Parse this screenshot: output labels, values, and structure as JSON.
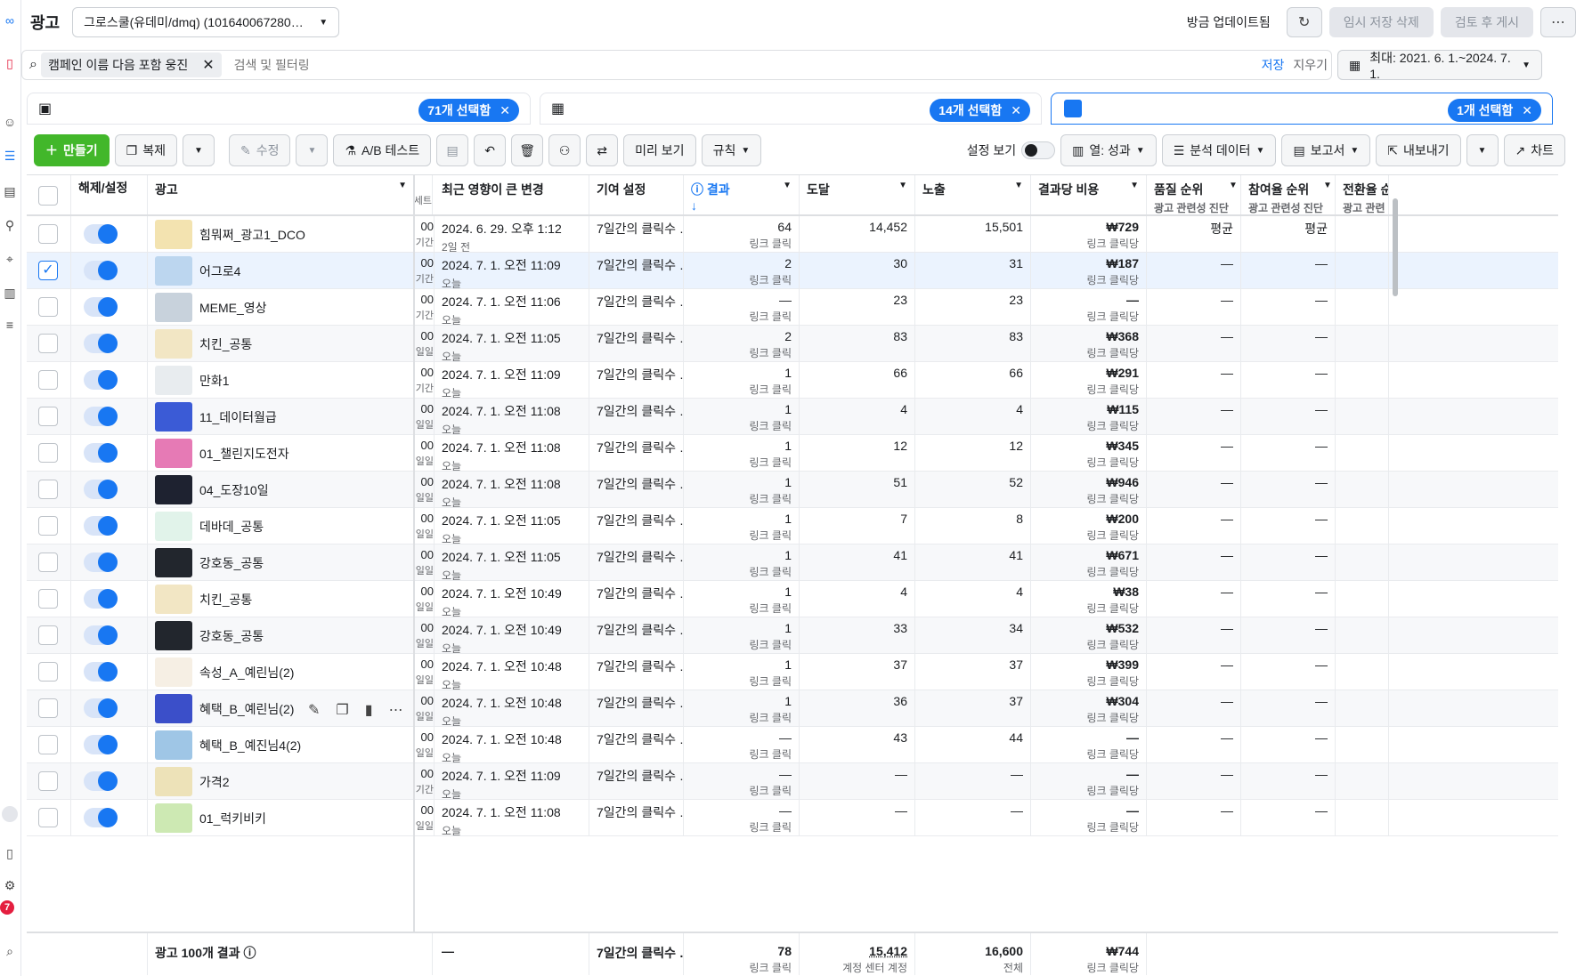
{
  "title": "광고",
  "account": "그로스쿨(유데미/dmq) (101640067280…",
  "top": {
    "updated": "방금 업데이트됨",
    "discard": "임시 저장 삭제",
    "review": "검토 후 게시"
  },
  "search": {
    "chip": "캠페인 이름 다음 포함 웅진",
    "placeholder": "검색 및 필터링",
    "save": "저장",
    "clear": "지우기",
    "date": "최대: 2021. 6. 1.~2024. 7. 1."
  },
  "panels": [
    "71개 선택함",
    "14개 선택함",
    "1개 선택함"
  ],
  "toolbar": {
    "create": "만들기",
    "duplicate": "복제",
    "edit": "수정",
    "ab": "A/B 테스트",
    "preview": "미리 보기",
    "rules": "규칙",
    "view_setup": "설정 보기",
    "columns": "열: 성과",
    "breakdown": "분석 데이터",
    "reports": "보고서",
    "export": "내보내기",
    "chart": "차트"
  },
  "headers": {
    "onoff": "해제/설정",
    "ad": "광고",
    "set": "세트",
    "change": "최근 영향이 큰 변경",
    "attribution": "기여 설정",
    "results": "결과",
    "reach": "도달",
    "impressions": "노출",
    "cpr": "결과당 비용",
    "quality": "품질 순위",
    "quality_sub": "광고 관련성 진단",
    "engage": "참여율 순위",
    "engage_sub": "광고 관련성 진단",
    "conv": "전환율 순",
    "conv_sub": "광고 관련"
  },
  "rows": [
    {
      "name": "힘뭐쩌_광고1_DCO",
      "frag": "00",
      "frag2": "기간",
      "change": "2024. 6. 29. 오후 1:12",
      "ago": "2일 전",
      "attr": "7일간의 클릭수 …",
      "res": "64",
      "rsub": "링크 클릭",
      "reach": "14,452",
      "imp": "15,501",
      "cpr": "₩729",
      "csub": "링크 클릭당",
      "q": "평균",
      "e": "평균"
    },
    {
      "name": "어그로4",
      "frag": "00",
      "frag2": "기간",
      "change": "2024. 7. 1. 오전 11:09",
      "ago": "오늘",
      "attr": "7일간의 클릭수 …",
      "res": "2",
      "rsub": "링크 클릭",
      "reach": "30",
      "imp": "31",
      "cpr": "₩187",
      "csub": "링크 클릭당",
      "q": "—",
      "e": "—"
    },
    {
      "name": "MEME_영상",
      "frag": "00",
      "frag2": "기간",
      "change": "2024. 7. 1. 오전 11:06",
      "ago": "오늘",
      "attr": "7일간의 클릭수 …",
      "res": "—",
      "rsub": "링크 클릭",
      "reach": "23",
      "imp": "23",
      "cpr": "—",
      "csub": "링크 클릭당",
      "q": "—",
      "e": "—"
    },
    {
      "name": "치킨_공통",
      "frag": "00",
      "frag2": "일일",
      "change": "2024. 7. 1. 오전 11:05",
      "ago": "오늘",
      "attr": "7일간의 클릭수 …",
      "res": "2",
      "rsub": "링크 클릭",
      "reach": "83",
      "imp": "83",
      "cpr": "₩368",
      "csub": "링크 클릭당",
      "q": "—",
      "e": "—"
    },
    {
      "name": "만화1",
      "frag": "00",
      "frag2": "기간",
      "change": "2024. 7. 1. 오전 11:09",
      "ago": "오늘",
      "attr": "7일간의 클릭수 …",
      "res": "1",
      "rsub": "링크 클릭",
      "reach": "66",
      "imp": "66",
      "cpr": "₩291",
      "csub": "링크 클릭당",
      "q": "—",
      "e": "—"
    },
    {
      "name": "11_데이터월급",
      "frag": "00",
      "frag2": "일일",
      "change": "2024. 7. 1. 오전 11:08",
      "ago": "오늘",
      "attr": "7일간의 클릭수 …",
      "res": "1",
      "rsub": "링크 클릭",
      "reach": "4",
      "imp": "4",
      "cpr": "₩115",
      "csub": "링크 클릭당",
      "q": "—",
      "e": "—"
    },
    {
      "name": "01_챌린지도전자",
      "frag": "00",
      "frag2": "일일",
      "change": "2024. 7. 1. 오전 11:08",
      "ago": "오늘",
      "attr": "7일간의 클릭수 …",
      "res": "1",
      "rsub": "링크 클릭",
      "reach": "12",
      "imp": "12",
      "cpr": "₩345",
      "csub": "링크 클릭당",
      "q": "—",
      "e": "—"
    },
    {
      "name": "04_도장10일",
      "frag": "00",
      "frag2": "일일",
      "change": "2024. 7. 1. 오전 11:08",
      "ago": "오늘",
      "attr": "7일간의 클릭수 …",
      "res": "1",
      "rsub": "링크 클릭",
      "reach": "51",
      "imp": "52",
      "cpr": "₩946",
      "csub": "링크 클릭당",
      "q": "—",
      "e": "—"
    },
    {
      "name": "데바데_공통",
      "frag": "00",
      "frag2": "일일",
      "change": "2024. 7. 1. 오전 11:05",
      "ago": "오늘",
      "attr": "7일간의 클릭수 …",
      "res": "1",
      "rsub": "링크 클릭",
      "reach": "7",
      "imp": "8",
      "cpr": "₩200",
      "csub": "링크 클릭당",
      "q": "—",
      "e": "—"
    },
    {
      "name": "강호동_공통",
      "frag": "00",
      "frag2": "일일",
      "change": "2024. 7. 1. 오전 11:05",
      "ago": "오늘",
      "attr": "7일간의 클릭수 …",
      "res": "1",
      "rsub": "링크 클릭",
      "reach": "41",
      "imp": "41",
      "cpr": "₩671",
      "csub": "링크 클릭당",
      "q": "—",
      "e": "—"
    },
    {
      "name": "치킨_공통",
      "frag": "00",
      "frag2": "일일",
      "change": "2024. 7. 1. 오전 10:49",
      "ago": "오늘",
      "attr": "7일간의 클릭수 …",
      "res": "1",
      "rsub": "링크 클릭",
      "reach": "4",
      "imp": "4",
      "cpr": "₩38",
      "csub": "링크 클릭당",
      "q": "—",
      "e": "—"
    },
    {
      "name": "강호동_공통",
      "frag": "00",
      "frag2": "일일",
      "change": "2024. 7. 1. 오전 10:49",
      "ago": "오늘",
      "attr": "7일간의 클릭수 …",
      "res": "1",
      "rsub": "링크 클릭",
      "reach": "33",
      "imp": "34",
      "cpr": "₩532",
      "csub": "링크 클릭당",
      "q": "—",
      "e": "—"
    },
    {
      "name": "속성_A_예린님(2)",
      "frag": "00",
      "frag2": "일일",
      "change": "2024. 7. 1. 오전 10:48",
      "ago": "오늘",
      "attr": "7일간의 클릭수 …",
      "res": "1",
      "rsub": "링크 클릭",
      "reach": "37",
      "imp": "37",
      "cpr": "₩399",
      "csub": "링크 클릭당",
      "q": "—",
      "e": "—"
    },
    {
      "name": "혜택_B_예린님(2)",
      "frag": "00",
      "frag2": "일일",
      "change": "2024. 7. 1. 오전 10:48",
      "ago": "오늘",
      "attr": "7일간의 클릭수 …",
      "res": "1",
      "rsub": "링크 클릭",
      "reach": "36",
      "imp": "37",
      "cpr": "₩304",
      "csub": "링크 클릭당",
      "q": "—",
      "e": "—"
    },
    {
      "name": "혜택_B_예진님4(2)",
      "frag": "00",
      "frag2": "일일",
      "change": "2024. 7. 1. 오전 10:48",
      "ago": "오늘",
      "attr": "7일간의 클릭수 …",
      "res": "—",
      "rsub": "링크 클릭",
      "reach": "43",
      "imp": "44",
      "cpr": "—",
      "csub": "링크 클릭당",
      "q": "—",
      "e": "—"
    },
    {
      "name": "가격2",
      "frag": "00",
      "frag2": "기간",
      "change": "2024. 7. 1. 오전 11:09",
      "ago": "오늘",
      "attr": "7일간의 클릭수 …",
      "res": "—",
      "rsub": "링크 클릭",
      "reach": "—",
      "imp": "—",
      "cpr": "—",
      "csub": "링크 클릭당",
      "q": "—",
      "e": "—"
    },
    {
      "name": "01_럭키비키",
      "frag": "00",
      "frag2": "일일",
      "change": "2024. 7. 1. 오전 11:08",
      "ago": "오늘",
      "attr": "7일간의 클릭수 …",
      "res": "—",
      "rsub": "링크 클릭",
      "reach": "—",
      "imp": "—",
      "cpr": "—",
      "csub": "링크 클릭당",
      "q": "—",
      "e": "—"
    }
  ],
  "footer": {
    "label": "광고 100개 결과",
    "change": "—",
    "attr": "7일간의 클릭수 …",
    "res": "78",
    "rsub": "링크 클릭",
    "reach": "15,412",
    "reach_sub": "계정 센터 계정",
    "imp": "16,600",
    "imp_sub": "전체",
    "cpr": "₩744",
    "cpr_sub": "링크 클릭당"
  },
  "badge_count": "7",
  "colors": {
    "accent": "#1877f2",
    "create": "#42b72a"
  }
}
